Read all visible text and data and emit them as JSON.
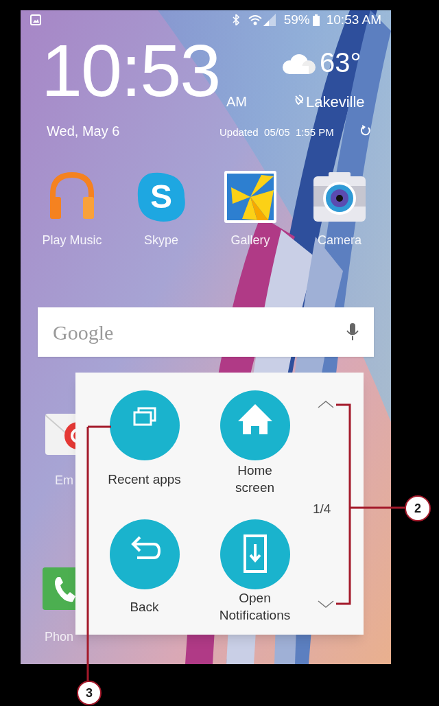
{
  "status_bar": {
    "battery": "59%",
    "time": "10:53 AM"
  },
  "clock_widget": {
    "time": "10:53",
    "ampm": "AM",
    "date": "Wed, May 6",
    "temperature": "63°",
    "location": "Lakeville",
    "updated": "Updated  05/05  1:55 PM"
  },
  "apps": [
    {
      "label": "Play Music",
      "kind": "music"
    },
    {
      "label": "Skype",
      "kind": "skype",
      "glyph": "S"
    },
    {
      "label": "Gallery",
      "kind": "gallery"
    },
    {
      "label": "Camera",
      "kind": "camera"
    }
  ],
  "search_bar": {
    "logo": "Google"
  },
  "background_apps": [
    {
      "label": "Em",
      "kind": "email"
    },
    {
      "label": "Phon",
      "kind": "phone"
    }
  ],
  "assistant_menu": {
    "items": [
      {
        "label": "Recent apps",
        "kind": "recent"
      },
      {
        "label": "Home screen",
        "kind": "home"
      },
      {
        "label": "Back",
        "kind": "back"
      },
      {
        "label": "Open Notifications",
        "kind": "notifications"
      }
    ],
    "page": "1/4"
  },
  "callouts": [
    {
      "number": "2",
      "kind": "bracket"
    },
    {
      "number": "3",
      "kind": "line"
    }
  ]
}
